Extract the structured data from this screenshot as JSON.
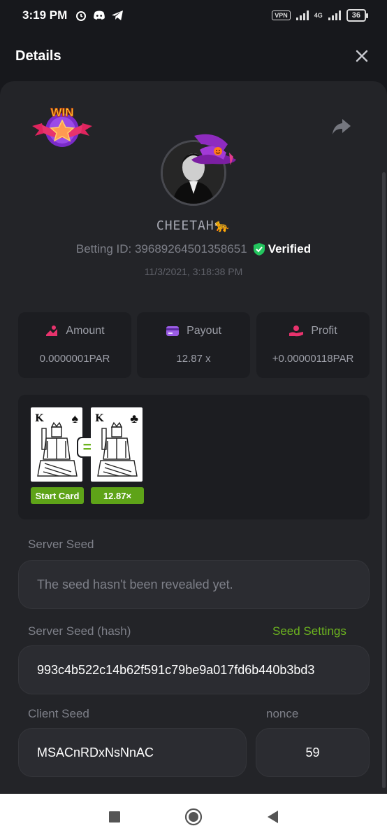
{
  "status_bar": {
    "time": "3:19 PM",
    "vpn": "VPN",
    "network": "4G",
    "battery": "36"
  },
  "header": {
    "title": "Details"
  },
  "profile": {
    "username": "CHEETAH🐆",
    "betting_id_label": "Betting ID: 39689264501358651",
    "verified": "Verified",
    "timestamp": "11/3/2021, 3:18:38 PM",
    "badge": "WIN"
  },
  "stats": [
    {
      "label": "Amount",
      "value": "0.0000001PAR",
      "icon": "amount-icon"
    },
    {
      "label": "Payout",
      "value": "12.87 x",
      "icon": "card-icon"
    },
    {
      "label": "Profit",
      "value": "+0.00000118PAR",
      "icon": "profit-icon"
    }
  ],
  "cards": {
    "start_card": {
      "rank": "K",
      "suit": "♠",
      "tag": "Start Card"
    },
    "result_card": {
      "rank": "K",
      "suit": "♣",
      "tag": "12.87×"
    },
    "equals": "="
  },
  "server_seed": {
    "label": "Server Seed",
    "value": "The seed hasn't been revealed yet."
  },
  "server_seed_hash": {
    "label": "Server Seed (hash)",
    "link": "Seed Settings",
    "value": "993c4b522c14b62f591c79be9a017fd6b440b3bd3"
  },
  "client_seed": {
    "label": "Client Seed",
    "value": "MSACnRDxNsNnAC"
  },
  "nonce": {
    "label": "nonce",
    "value": "59"
  },
  "colors": {
    "accent_green": "#6cb31f",
    "verified_green": "#23c55e",
    "background": "#17181c",
    "panel": "#232428"
  }
}
